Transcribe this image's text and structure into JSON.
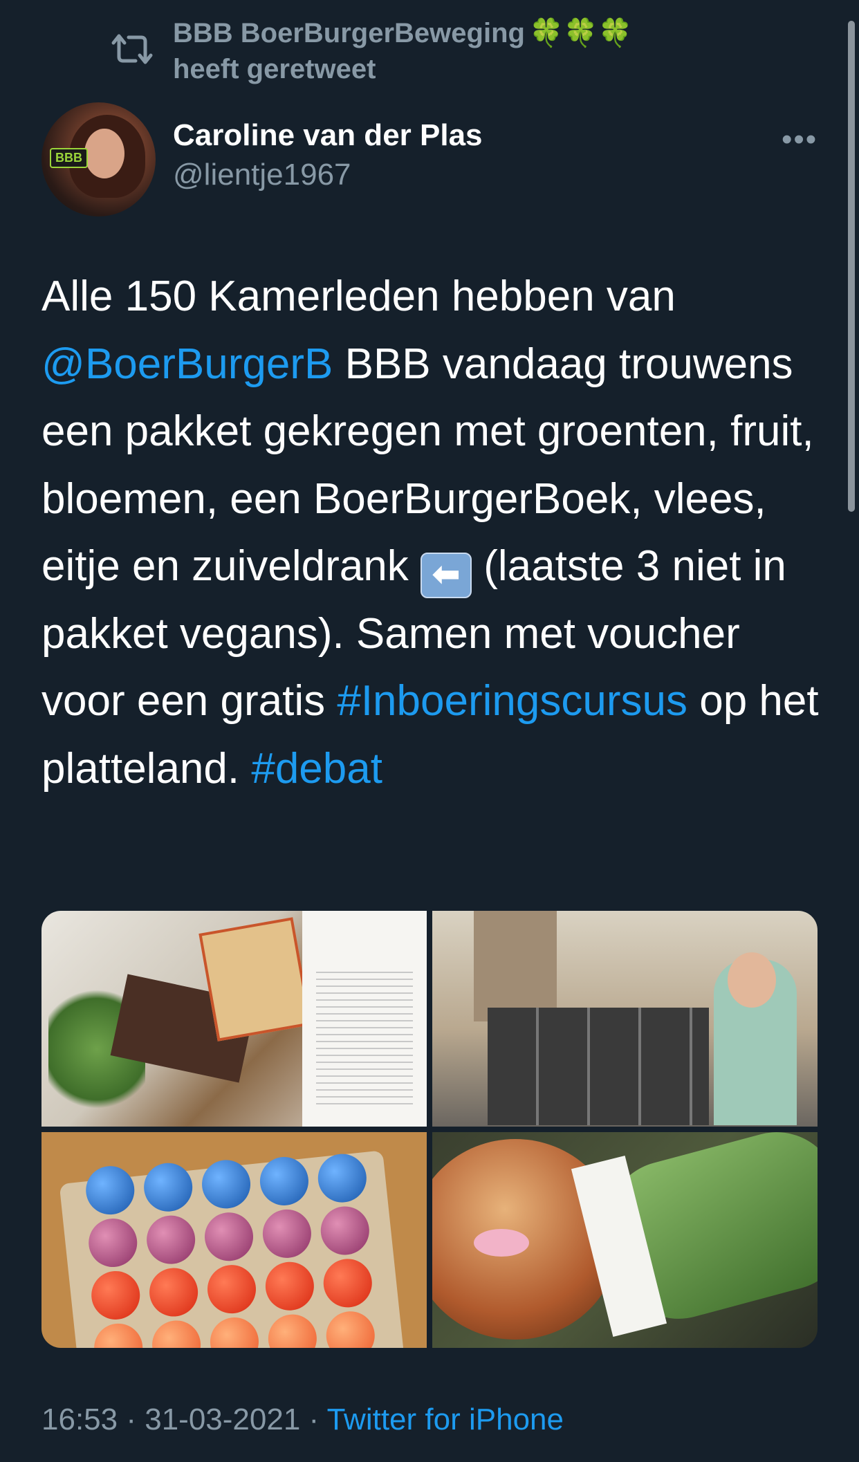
{
  "retweet": {
    "by": "BBB BoerBurgerBeweging",
    "emoji": "🍀🍀🍀",
    "suffix": "heeft geretweet"
  },
  "author": {
    "display_name": "Caroline van der Plas",
    "handle": "@lientje1967",
    "avatar_badge": "BBB"
  },
  "more_label": "•••",
  "tweet": {
    "t1": "Alle 150 Kamerleden hebben van",
    "mention": "@BoerBurgerB",
    "t2": " BBB vandaag trouwens een pakket gekregen met groenten, fruit, bloemen, een BoerBurgerBoek, vlees, eitje en zuiveldrank ",
    "emoji": "⬅",
    "t3": " (laatste 3 niet in pakket vegans). Samen met voucher voor een gratis ",
    "hashtag1": "#Inboeringscursus",
    "t4": " op het platteland. ",
    "hashtag2": "#debat"
  },
  "media": [
    {
      "alt": "photo-package-contents"
    },
    {
      "alt": "photo-woman-at-street-display"
    },
    {
      "alt": "photo-colored-eggs"
    },
    {
      "alt": "photo-pear-and-cucumber"
    }
  ],
  "meta": {
    "time": "16:53",
    "sep1": " · ",
    "date": "31-03-2021",
    "sep2": " · ",
    "source": "Twitter for iPhone"
  },
  "colors": {
    "background": "#15202b",
    "link": "#1d9bf0",
    "muted": "#8899a6"
  }
}
